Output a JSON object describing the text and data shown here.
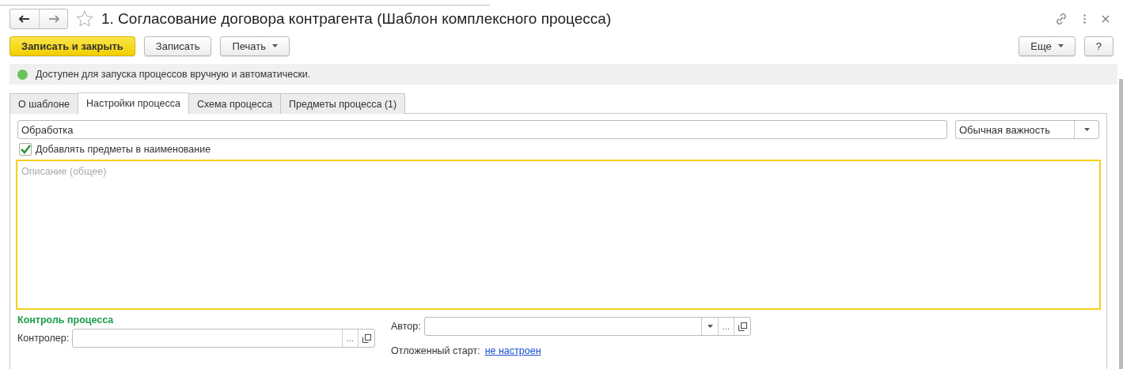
{
  "window": {
    "title": "1. Согласование договора контрагента (Шаблон комплексного процесса)",
    "favorite": false
  },
  "toolbar": {
    "buttons": [
      {
        "label": "Записать и закрыть",
        "kind": "primary"
      },
      {
        "label": "Записать",
        "kind": "plain"
      },
      {
        "label": "Печать",
        "kind": "menu"
      }
    ],
    "right_buttons": [
      {
        "label": "Еще",
        "kind": "menu"
      },
      {
        "label": "?",
        "kind": "plain"
      }
    ]
  },
  "status": {
    "text": "Доступен для запуска процессов вручную и автоматически.",
    "color": "#6ac259"
  },
  "tabs": [
    {
      "label": "О шаблоне",
      "selected": false
    },
    {
      "label": "Настройки процесса",
      "selected": true
    },
    {
      "label": "Схема процесса",
      "selected": false
    },
    {
      "label": "Предметы процесса (1)",
      "selected": false
    }
  ],
  "settings": {
    "name_field": {
      "value": "Обработка"
    },
    "importance": {
      "value": "Обычная важность"
    },
    "add_subjects": {
      "label": "Добавлять предметы в наименование",
      "checked": true
    },
    "description": {
      "placeholder": "Описание (общее)"
    },
    "control_section": {
      "title": "Контроль процесса",
      "controller": {
        "label": "Контролер:",
        "select_button": "..."
      }
    },
    "author": {
      "label": "Автор:",
      "select_button": "..."
    },
    "deferred_start": {
      "label": "Отложенный старт:",
      "link": "не настроен"
    }
  }
}
